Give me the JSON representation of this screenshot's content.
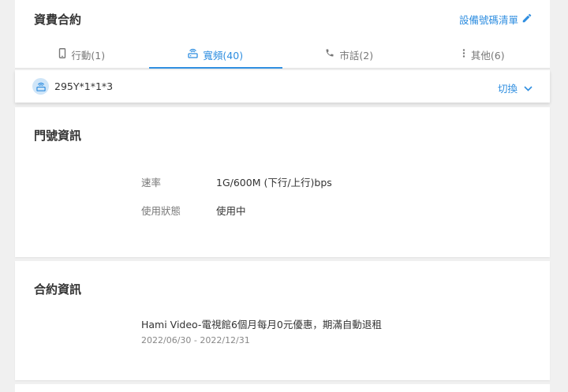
{
  "header": {
    "title": "資費合約",
    "list_link": "設備號碼清單"
  },
  "tabs": [
    {
      "label": "行動(1)",
      "icon": "mobile-phone-icon",
      "active": false
    },
    {
      "label": "寬頻(40)",
      "icon": "router-icon",
      "active": true
    },
    {
      "label": "市話(2)",
      "icon": "telephone-icon",
      "active": false
    },
    {
      "label": "其他(6)",
      "icon": "more-vertical-icon",
      "active": false
    }
  ],
  "account": {
    "number": "295Y*1*1*3",
    "switch_label": "切換"
  },
  "line_info": {
    "title": "門號資訊",
    "rows": [
      {
        "label": "速率",
        "value": "1G/600M (下行/上行)bps"
      },
      {
        "label": "使用狀態",
        "value": "使用中"
      }
    ]
  },
  "contract_info": {
    "title": "合約資訊",
    "promo_name": "Hami Video-電視館6個月每月0元優惠，期滿自動退租",
    "promo_dates": "2022/06/30 - 2022/12/31"
  },
  "colors": {
    "accent": "#2f8ee0",
    "background": "#f0f0f0",
    "card": "#ffffff"
  }
}
